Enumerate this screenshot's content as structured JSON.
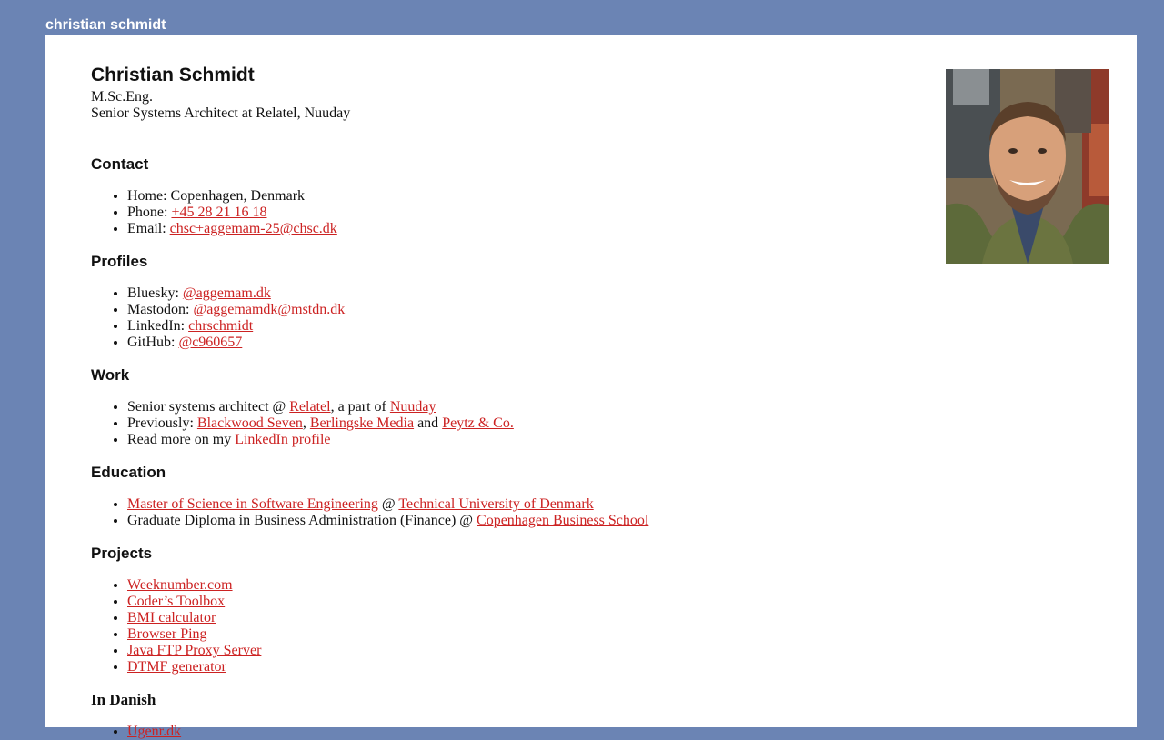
{
  "site_title": "christian schmidt",
  "name": "Christian Schmidt",
  "degree": "M.Sc.Eng.",
  "role": "Senior Systems Architect at Relatel, Nuuday",
  "contact": {
    "heading": "Contact",
    "home_label": "Home: ",
    "home_value": "Copenhagen, Denmark",
    "phone_label": "Phone: ",
    "phone_value": "+45 28 21 16 18",
    "email_label": "Email: ",
    "email_value": "chsc+aggemam-25@chsc.dk"
  },
  "profiles": {
    "heading": "Profiles",
    "items": [
      {
        "label": "Bluesky: ",
        "link": "@aggemam.dk"
      },
      {
        "label": "Mastodon: ",
        "link": "@aggemamdk@mstdn.dk"
      },
      {
        "label": "LinkedIn: ",
        "link": "chrschmidt"
      },
      {
        "label": "GitHub: ",
        "link": "@c960657"
      }
    ]
  },
  "work": {
    "heading": "Work",
    "line1_prefix": "Senior systems architect @ ",
    "line1_link1": "Relatel",
    "line1_mid": ", a part of ",
    "line1_link2": "Nuuday",
    "line2_prefix": "Previously: ",
    "line2_link1": "Blackwood Seven",
    "line2_sep": ", ",
    "line2_link2": "Berlingske Media",
    "line2_and": " and ",
    "line2_link3": "Peytz & Co.",
    "line3_prefix": "Read more on my ",
    "line3_link": "LinkedIn profile"
  },
  "education": {
    "heading": "Education",
    "line1_link1": "Master of Science in Software Engineering",
    "line1_at": " @ ",
    "line1_link2": "Technical University of Denmark",
    "line2_prefix": "Graduate Diploma in Business Administration (Finance) @ ",
    "line2_link": "Copenhagen Business School"
  },
  "projects": {
    "heading": "Projects",
    "items": [
      "Weeknumber.com",
      "Coder’s Toolbox",
      "BMI calculator",
      "Browser Ping",
      "Java FTP Proxy Server",
      "DTMF generator"
    ]
  },
  "danish": {
    "heading": "In Danish",
    "items": [
      "Ugenr.dk"
    ]
  }
}
